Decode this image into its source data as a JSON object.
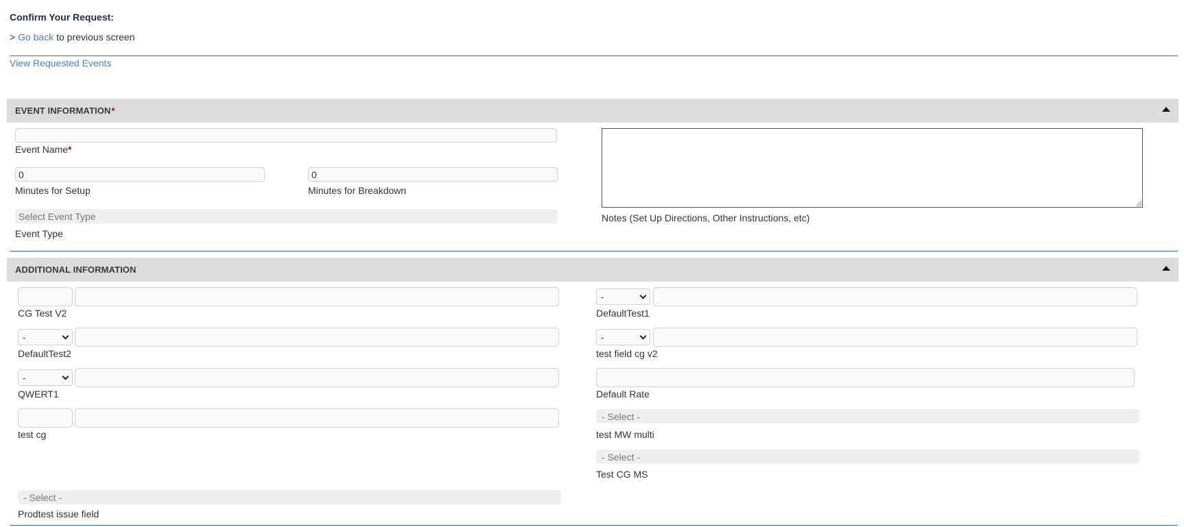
{
  "header": {
    "confirm_title": "Confirm Your Request:",
    "go_back_prefix": ">",
    "go_back_link": "Go back",
    "go_back_suffix": "to previous screen",
    "view_requested_events": "View Requested Events"
  },
  "event_information": {
    "title": "EVENT INFORMATION",
    "required_mark": "*",
    "event_name_label": "Event Name",
    "event_name_value": "",
    "setup_value": "0",
    "setup_label": "Minutes for Setup",
    "breakdown_value": "0",
    "breakdown_label": "Minutes for Breakdown",
    "event_type_placeholder": "Select Event Type",
    "event_type_label": "Event Type",
    "notes_label": "Notes (Set Up Directions, Other Instructions, etc)",
    "notes_value": ""
  },
  "additional_information": {
    "title": "ADDITIONAL INFORMATION",
    "cg_test_v2_label": "CG Test V2",
    "default_test1_label": "DefaultTest1",
    "default_test1_select": "-",
    "default_test2_label": "DefaultTest2",
    "default_test2_select": "-",
    "test_field_cg_v2_label": "test field cg v2",
    "test_field_cg_v2_select": "-",
    "qwert1_label": "QWERT1",
    "qwert1_select": "-",
    "default_rate_label": "Default Rate",
    "test_cg_label": "test cg",
    "test_mw_multi_placeholder": "- Select -",
    "test_mw_multi_label": "test MW multi",
    "test_cg_ms_placeholder": "- Select -",
    "test_cg_ms_label": "Test CG MS",
    "prodtest_placeholder": "- Select -",
    "prodtest_label": "Prodtest issue field"
  },
  "colors": {
    "link": "#4a7fc1",
    "divider": "#3f6ea4",
    "section_bg": "#dcdcdc",
    "required": "#8b1010"
  }
}
